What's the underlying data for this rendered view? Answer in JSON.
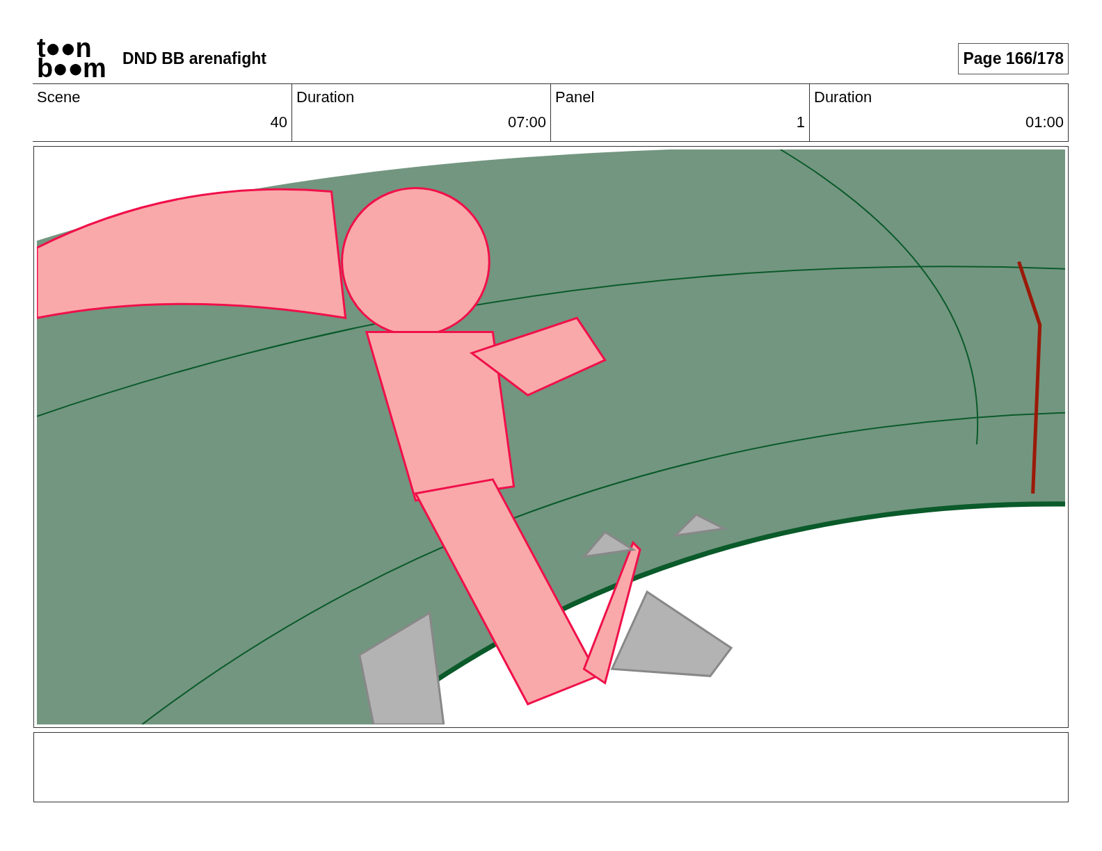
{
  "header": {
    "logo_lines": [
      "t●●n",
      "b●●m"
    ],
    "title": "DND BB arenafight",
    "page": "Page 166/178"
  },
  "info_table": {
    "columns": [
      "Scene",
      "Duration",
      "Panel",
      "Duration"
    ],
    "values": [
      "40",
      "07:00",
      "1",
      "01:00"
    ]
  }
}
